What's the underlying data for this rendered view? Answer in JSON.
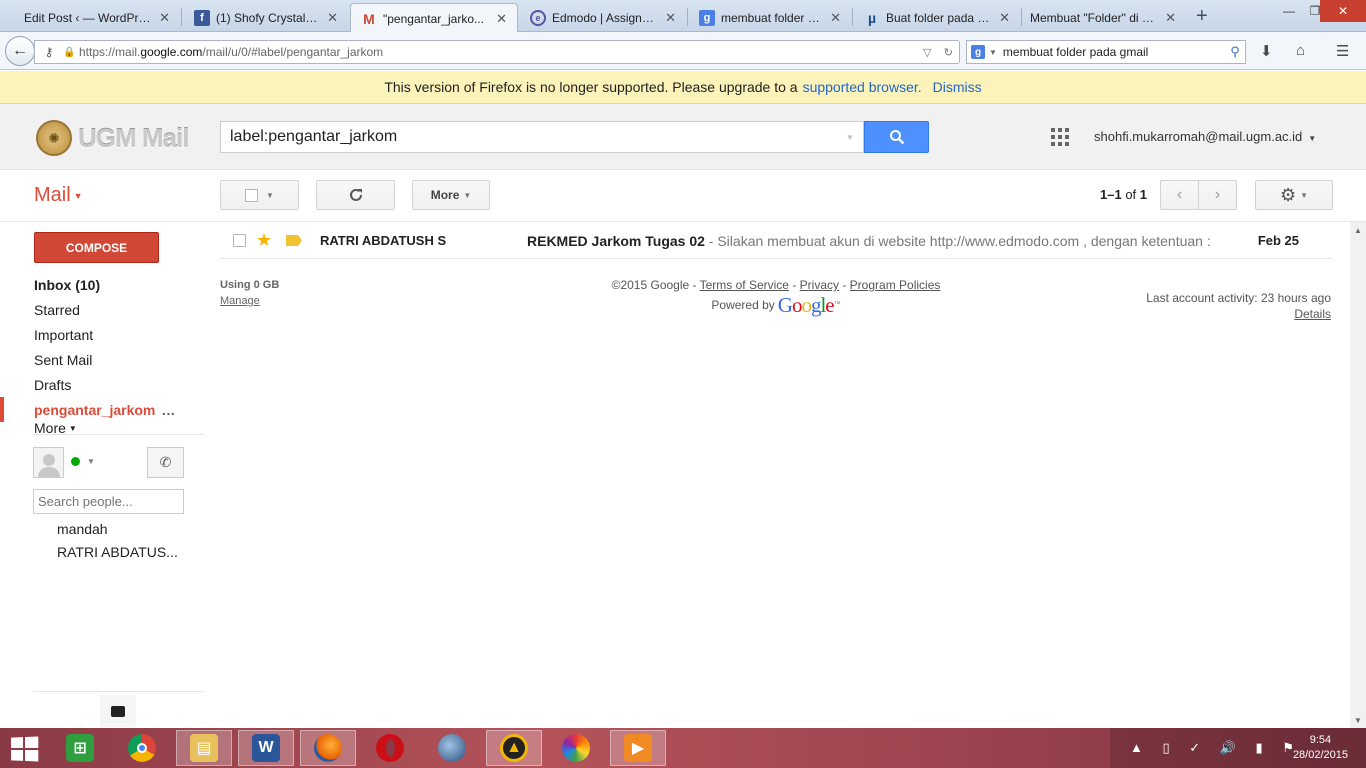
{
  "browser": {
    "tabs": [
      {
        "title": "Edit Post ‹ — WordPress",
        "icon": "wordpress-icon"
      },
      {
        "title": "(1) Shofy Crystal - ...",
        "icon": "facebook-icon"
      },
      {
        "title": "\"pengantar_jarko...",
        "icon": "gmail-icon",
        "active": true
      },
      {
        "title": "Edmodo | Assignm...",
        "icon": "edmodo-icon"
      },
      {
        "title": "membuat folder p...",
        "icon": "google-icon"
      },
      {
        "title": "Buat folder pada G...",
        "icon": "utorrent-icon"
      },
      {
        "title": "Membuat \"Folder\" di G...",
        "icon": "page-icon"
      }
    ],
    "url_prefix": "https://mail.",
    "url_domain": "google.com",
    "url_suffix": "/mail/u/0/#label/pengantar_jarkom",
    "search_query": "membuat folder pada gmail"
  },
  "notice": {
    "text": "This version of Firefox is no longer supported. Please upgrade to a",
    "link": "supported browser.",
    "dismiss": "Dismiss"
  },
  "header": {
    "logo_text": "UGM Mail",
    "search_value": "label:pengantar_jarkom",
    "account": "shohfi.mukarromah@mail.ugm.ac.id"
  },
  "toolbar": {
    "mail_label": "Mail",
    "more_label": "More",
    "pager_range": "1–1",
    "pager_of": "of",
    "pager_total": "1"
  },
  "nav": {
    "compose": "COMPOSE",
    "items": [
      {
        "label": "Inbox (10)"
      },
      {
        "label": "Starred"
      },
      {
        "label": "Important"
      },
      {
        "label": "Sent Mail"
      },
      {
        "label": "Drafts"
      },
      {
        "label": "pengantar_jarkom"
      },
      {
        "label": "More"
      }
    ]
  },
  "hangouts": {
    "search_placeholder": "Search people...",
    "contacts": [
      "mandah",
      "RATRI ABDATUS..."
    ]
  },
  "messages": [
    {
      "sender": "RATRI ABDATUSH S",
      "subject": "REKMED Jarkom Tugas 02",
      "snippet": " - Silakan membuat akun di website http://www.edmodo.com , dengan ketentuan :",
      "date": "Feb 25"
    }
  ],
  "footer": {
    "storage": "Using 0 GB",
    "manage": "Manage",
    "copyright": "©2015 Google - ",
    "terms": "Terms of Service",
    "sep": " - ",
    "privacy": "Privacy",
    "policies": "Program Policies",
    "powered_by": "Powered by",
    "google": "Google",
    "activity": "Last account activity: 23 hours ago",
    "details": "Details"
  },
  "taskbar": {
    "time": "9:54",
    "date": "28/02/2015"
  },
  "colors": {
    "gmail_red": "#dd4b39",
    "search_blue": "#4d90fe",
    "compose_red": "#d14836",
    "notice_yellow": "#fbf3b9",
    "star_yellow": "#f4b400"
  }
}
